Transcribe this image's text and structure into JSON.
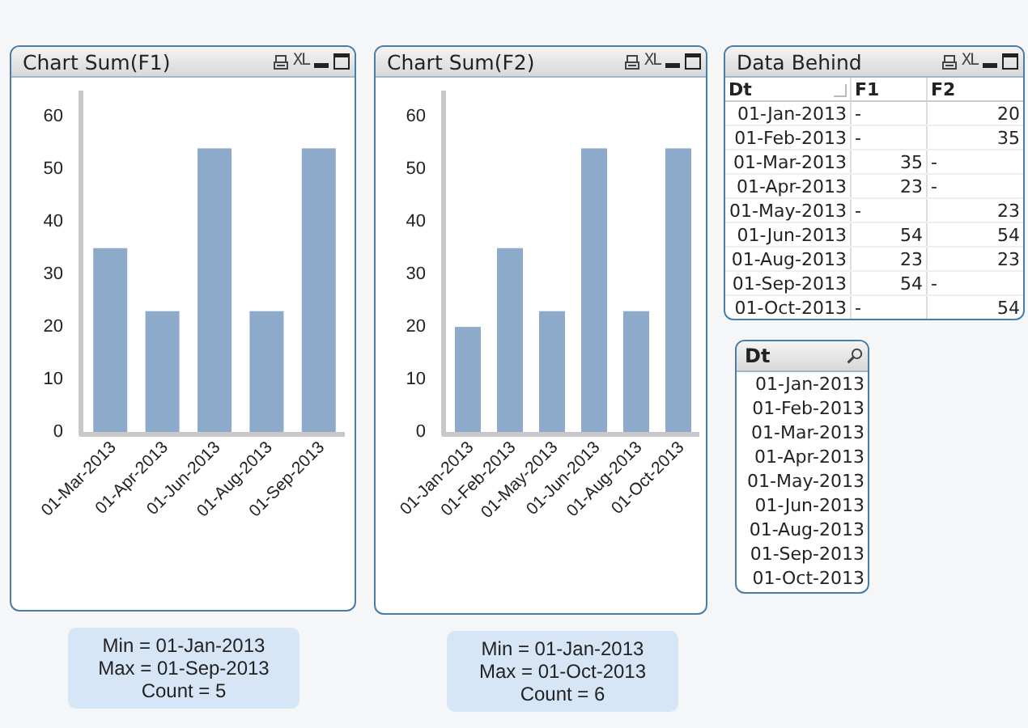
{
  "charts": [
    {
      "title": "Chart Sum(F1)",
      "xl": "XL",
      "chart_data": {
        "type": "bar",
        "categories": [
          "01-Mar-2013",
          "01-Apr-2013",
          "01-Jun-2013",
          "01-Aug-2013",
          "01-Sep-2013"
        ],
        "series": [
          {
            "color": "#8eaacb",
            "values": [
              35,
              23,
              54,
              23,
              54
            ]
          }
        ],
        "ylim": [
          0,
          65
        ],
        "yticks": [
          0,
          10,
          20,
          30,
          40,
          50,
          60
        ]
      }
    },
    {
      "title": "Chart Sum(F2)",
      "xl": "XL",
      "chart_data": {
        "type": "bar",
        "categories": [
          "01-Jan-2013",
          "01-Feb-2013",
          "01-May-2013",
          "01-Jun-2013",
          "01-Aug-2013",
          "01-Oct-2013"
        ],
        "series": [
          {
            "color": "#8eaacb",
            "values": [
              20,
              35,
              23,
              54,
              23,
              54
            ]
          }
        ],
        "ylim": [
          0,
          65
        ],
        "yticks": [
          0,
          10,
          20,
          30,
          40,
          50,
          60
        ]
      }
    }
  ],
  "table": {
    "title": "Data Behind",
    "xl": "XL",
    "columns": [
      "Dt",
      "F1",
      "F2"
    ],
    "rows": [
      [
        "01-Jan-2013",
        "-",
        "20"
      ],
      [
        "01-Feb-2013",
        "-",
        "35"
      ],
      [
        "01-Mar-2013",
        "35",
        "-"
      ],
      [
        "01-Apr-2013",
        "23",
        "-"
      ],
      [
        "01-May-2013",
        "-",
        "23"
      ],
      [
        "01-Jun-2013",
        "54",
        "54"
      ],
      [
        "01-Aug-2013",
        "23",
        "23"
      ],
      [
        "01-Sep-2013",
        "54",
        "-"
      ],
      [
        "01-Oct-2013",
        "-",
        "54"
      ]
    ]
  },
  "listbox": {
    "title": "Dt",
    "items": [
      "01-Jan-2013",
      "01-Feb-2013",
      "01-Mar-2013",
      "01-Apr-2013",
      "01-May-2013",
      "01-Jun-2013",
      "01-Aug-2013",
      "01-Sep-2013",
      "01-Oct-2013"
    ]
  },
  "text_boxes": [
    {
      "lines": [
        "Min = 01-Jan-2013",
        "Max = 01-Sep-2013",
        "Count = 5"
      ]
    },
    {
      "lines": [
        "Min = 01-Jan-2013",
        "Max = 01-Oct-2013",
        "Count = 6"
      ]
    }
  ]
}
